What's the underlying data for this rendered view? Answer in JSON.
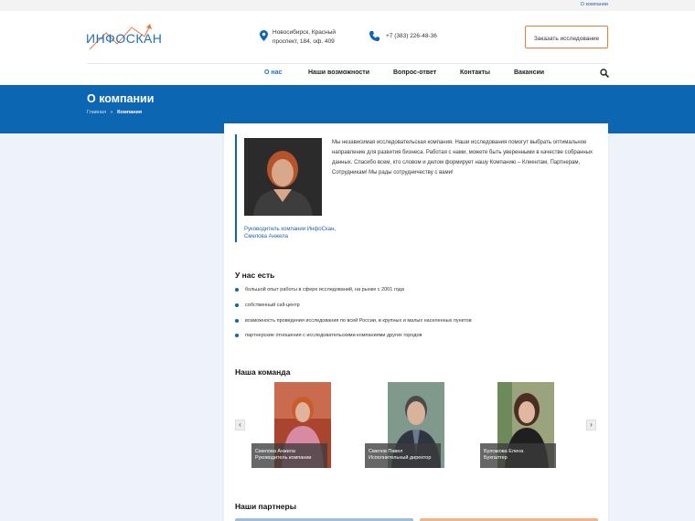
{
  "topbar": {
    "about_link": "О компании"
  },
  "header": {
    "logo_text": "ИНФОСКАН",
    "address": "Новосибирск, Красный проспект, 184, оф. 409",
    "phone": "+7 (383) 226-48-36",
    "order_button": "Заказать исследование"
  },
  "nav": {
    "items": [
      {
        "label": "О нас",
        "active": true
      },
      {
        "label": "Наши возможности"
      },
      {
        "label": "Вопрос-ответ"
      },
      {
        "label": "Контакты"
      },
      {
        "label": "Вакансии"
      }
    ]
  },
  "banner": {
    "title": "О компании",
    "breadcrumb_home": "Главная",
    "breadcrumb_sep": "»",
    "breadcrumb_current": "Компания"
  },
  "about": {
    "caption": "Руководитель компании ИнфоСкан, Смелова Анжела",
    "intro": "Мы независимая исследовательская компания. Наши исследования помогут выбрать оптимальное направление для развития бизнеса. Работая с нами, можете быть уверенными в качестве собранных данных. Спасибо всем, кто словом и делом формирует нашу Компанию – Клиентам, Партнерам, Сотрудникам! Мы рады сотрудничеству с вами!"
  },
  "features": {
    "title": "У нас есть",
    "items": [
      "большой опыт работы в сфере исследований, на рынке с 2001 года",
      "собственный call-центр",
      "возможность проведения исследования по всей России, в крупных и малых населенных пунктов",
      "партнерские отношения с исследовательскими компаниями других городов"
    ]
  },
  "team": {
    "title": "Наша команда",
    "prev": "‹",
    "next": "›",
    "members": [
      {
        "name": "Смелова Анжела",
        "role": "Руководитель компании"
      },
      {
        "name": "Смелов Павел",
        "role": "Исполнительный директор"
      },
      {
        "name": "Булгакова Елена",
        "role": "Бухгалтер"
      }
    ]
  },
  "partners": {
    "title": "Наши партнеры"
  },
  "colors": {
    "primary": "#0d66b2",
    "accent": "#e67a3c",
    "link": "#2a64a8"
  }
}
